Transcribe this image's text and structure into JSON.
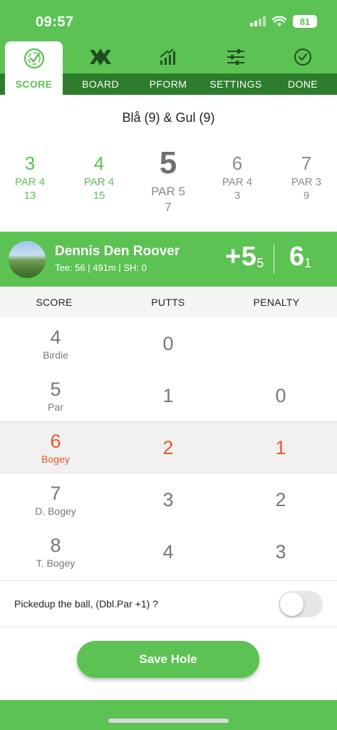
{
  "status_bar": {
    "time": "09:57",
    "battery": "81"
  },
  "tabs": [
    {
      "label": "SCORE",
      "icon": "target-check-icon",
      "active": true
    },
    {
      "label": "BOARD",
      "icon": "leaderboard-trophy-icon",
      "active": false
    },
    {
      "label": "PFORM",
      "icon": "performance-chart-icon",
      "active": false
    },
    {
      "label": "SETTINGS",
      "icon": "sliders-icon",
      "active": false
    },
    {
      "label": "DONE",
      "icon": "check-circle-icon",
      "active": false
    }
  ],
  "course_name": "Blå (9) & Gul (9)",
  "holes": [
    {
      "number": "3",
      "par": "PAR 4",
      "index": "13",
      "state": "done"
    },
    {
      "number": "4",
      "par": "PAR 4",
      "index": "15",
      "state": "done"
    },
    {
      "number": "5",
      "par": "PAR 5",
      "index": "7",
      "state": "current"
    },
    {
      "number": "6",
      "par": "PAR 4",
      "index": "3",
      "state": "future"
    },
    {
      "number": "7",
      "par": "PAR 3",
      "index": "9",
      "state": "future"
    }
  ],
  "player": {
    "name": "Dennis Den Roover",
    "info": "Tee: 56 | 491m | SH: 0",
    "to_par": "+5",
    "to_par_sub": "5",
    "strokes": "6",
    "strokes_sub": "1"
  },
  "columns": {
    "score": "SCORE",
    "putts": "PUTTS",
    "penalty": "PENALTY"
  },
  "rows": [
    {
      "score": "4",
      "label": "Birdie",
      "putts": "0",
      "penalty": "",
      "selected": false
    },
    {
      "score": "5",
      "label": "Par",
      "putts": "1",
      "penalty": "0",
      "selected": false
    },
    {
      "score": "6",
      "label": "Bogey",
      "putts": "2",
      "penalty": "1",
      "selected": true
    },
    {
      "score": "7",
      "label": "D. Bogey",
      "putts": "3",
      "penalty": "2",
      "selected": false
    },
    {
      "score": "8",
      "label": "T. Bogey",
      "putts": "4",
      "penalty": "3",
      "selected": false
    }
  ],
  "pickup": {
    "label": "Pickedup the ball, (Dbl.Par +1) ?",
    "on": false
  },
  "save_button": "Save Hole",
  "colors": {
    "brand_green": "#5cc253",
    "dark_green": "#2e7d2c",
    "highlight_orange": "#e8592d"
  }
}
